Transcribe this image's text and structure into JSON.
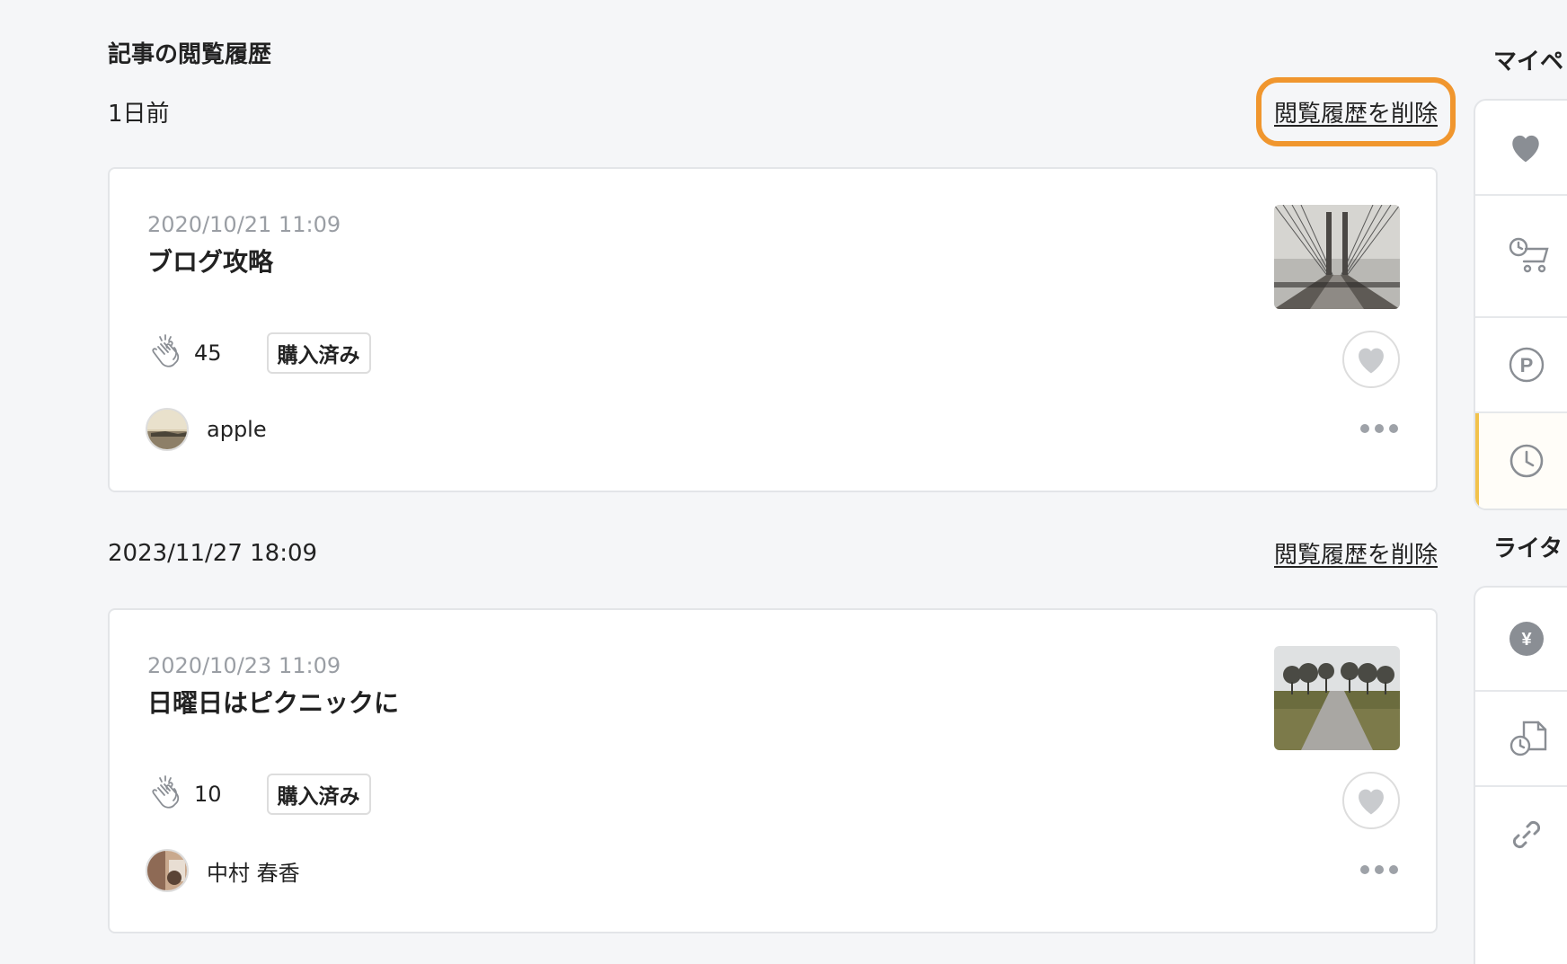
{
  "page": {
    "section_title": "記事の閲覧履歴"
  },
  "groups": [
    {
      "date_label": "1日前",
      "delete_label": "閲覧履歴を削除",
      "card": {
        "date": "2020/10/21 11:09",
        "title": "ブログ攻略",
        "claps": "45",
        "badge": "購入済み",
        "author": "apple",
        "thumbnail": "bridge-photo"
      }
    },
    {
      "date_label": "2023/11/27 18:09",
      "delete_label": "閲覧履歴を削除",
      "card": {
        "date": "2020/10/23 11:09",
        "title": "日曜日はピクニックに",
        "claps": "10",
        "badge": "購入済み",
        "author": "中村 春香",
        "thumbnail": "park-path-photo"
      }
    }
  ],
  "sidebar": {
    "mypage_title": "マイペ",
    "writer_title": "ライタ",
    "mypage_items": [
      {
        "icon": "heart-icon"
      },
      {
        "icon": "purchase-history-icon"
      },
      {
        "icon": "points-icon"
      },
      {
        "icon": "history-clock-icon",
        "active": true
      }
    ],
    "writer_items": [
      {
        "icon": "yen-icon"
      },
      {
        "icon": "file-history-icon"
      },
      {
        "icon": "link-icon"
      }
    ]
  },
  "colors": {
    "highlight": "#f0962e",
    "active_accent": "#f2c24b",
    "background": "#f5f6f8"
  }
}
